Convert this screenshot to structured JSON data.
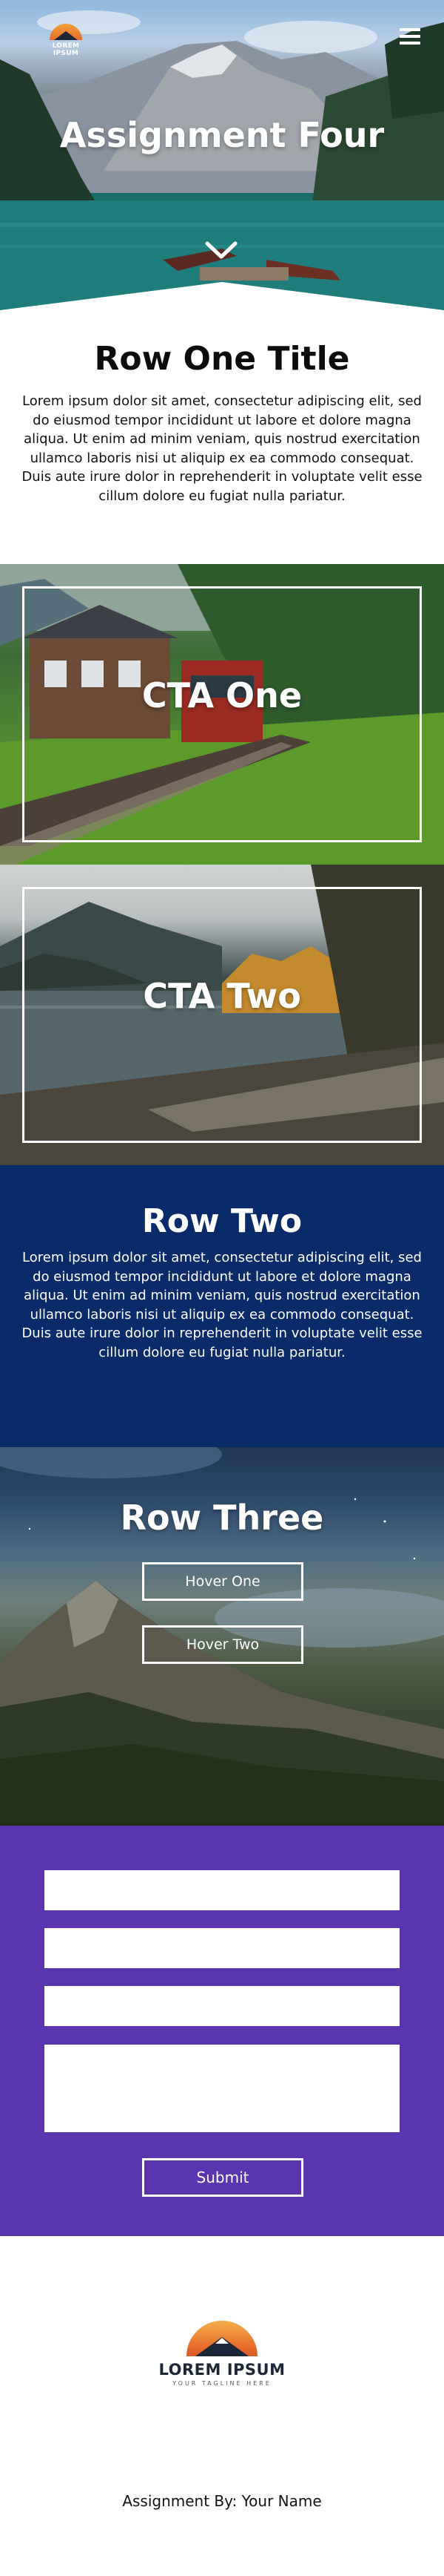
{
  "header": {
    "logo_text": "LOREM IPSUM",
    "title": "Assignment Four",
    "menu_icon": "hamburger-icon",
    "scroll_icon": "chevron-down-icon"
  },
  "row_one": {
    "title": "Row One Title",
    "body": "Lorem ipsum dolor sit amet, consectetur adipiscing elit, sed do eiusmod tempor incididunt ut labore et dolore magna aliqua. Ut enim ad minim veniam, quis nostrud exercitation ullamco laboris nisi ut aliquip ex ea commodo consequat. Duis aute irure dolor in reprehenderit in voluptate velit esse cillum dolore eu fugiat nulla pariatur."
  },
  "cta": [
    {
      "title": "CTA One"
    },
    {
      "title": "CTA Two"
    }
  ],
  "row_two": {
    "title": "Row Two",
    "body": "Lorem ipsum dolor sit amet, consectetur adipiscing elit, sed do eiusmod tempor incididunt ut labore et dolore magna aliqua. Ut enim ad minim veniam, quis nostrud exercitation ullamco laboris nisi ut aliquip ex ea commodo consequat. Duis aute irure dolor in reprehenderit in voluptate velit esse cillum dolore eu fugiat nulla pariatur."
  },
  "row_three": {
    "title": "Row Three",
    "buttons": [
      "Hover One",
      "Hover Two"
    ]
  },
  "form": {
    "submit_label": "Submit"
  },
  "footer": {
    "logo_name": "LOREM IPSUM",
    "logo_tagline": "YOUR TAGLINE HERE",
    "credit": "Assignment By: Your Name"
  },
  "colors": {
    "row_two_bg": "#0a2b6a",
    "form_bg": "#5b34b0",
    "logo_orange": "#e76b2b",
    "logo_navy": "#1b2738"
  }
}
